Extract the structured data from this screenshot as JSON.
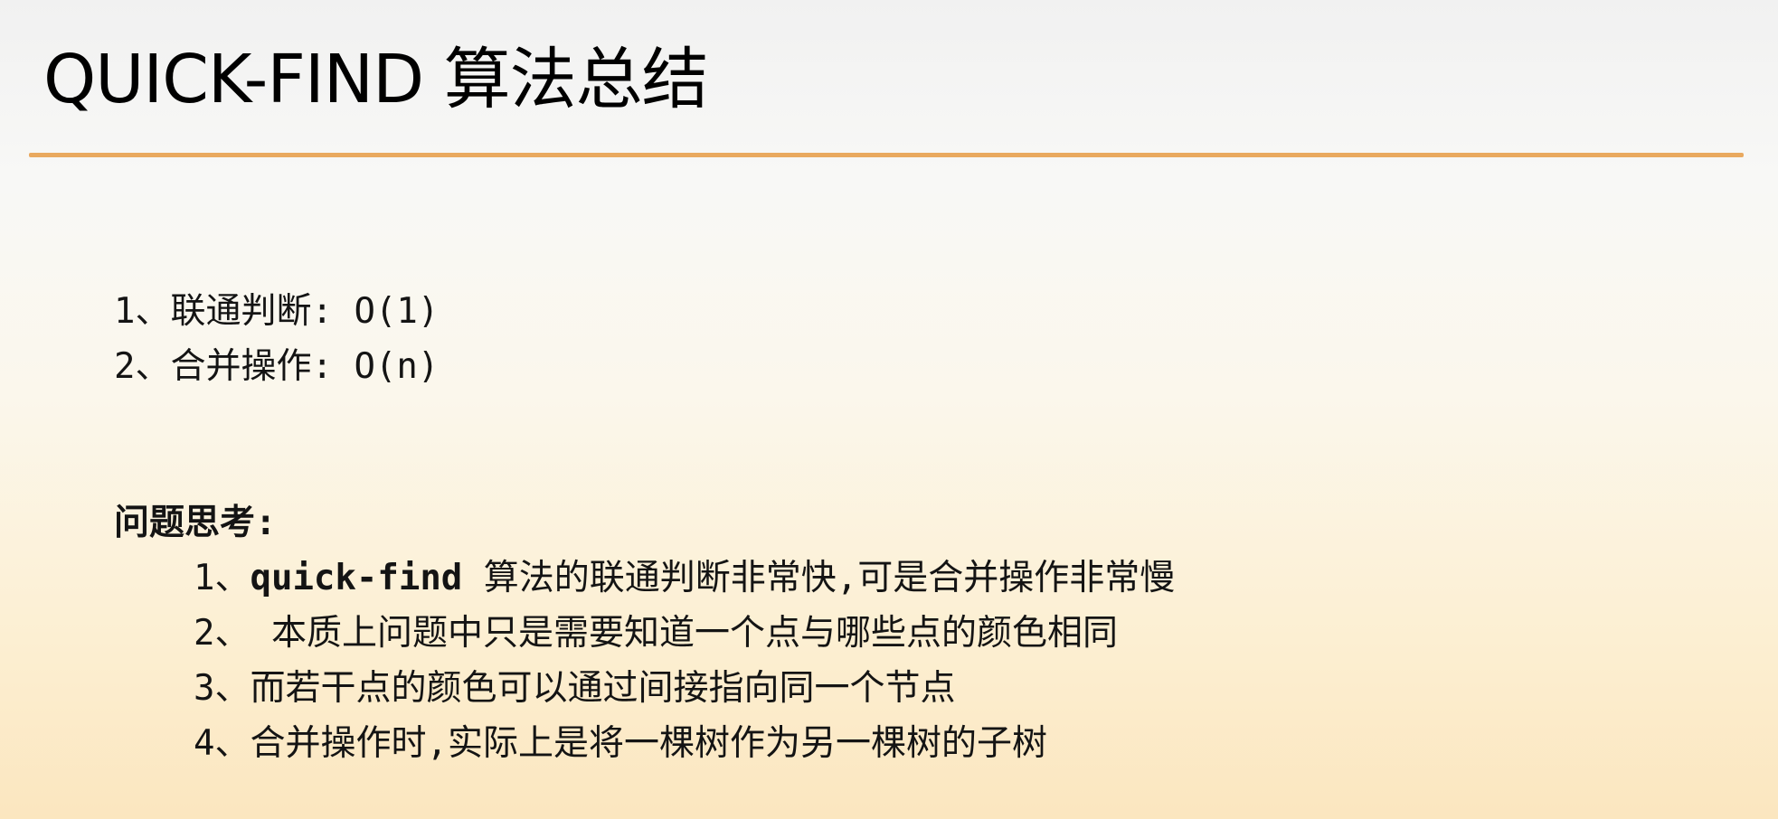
{
  "slide": {
    "title": "QUICK-FIND 算法总结",
    "accent_color": "#e9a95f"
  },
  "complexity": [
    "1、联通判断: O(1)",
    "2、合并操作: O(n)"
  ],
  "thinking": {
    "heading": "问题思考:",
    "items": [
      {
        "prefix": "1、",
        "keyword": "quick-find",
        "text": " 算法的联通判断非常快,可是合并操作非常慢"
      },
      {
        "prefix": "2、",
        "keyword": "",
        "text": " 本质上问题中只是需要知道一个点与哪些点的颜色相同"
      },
      {
        "prefix": "3、",
        "keyword": "",
        "text": "而若干点的颜色可以通过间接指向同一个节点"
      },
      {
        "prefix": "4、",
        "keyword": "",
        "text": "合并操作时,实际上是将一棵树作为另一棵树的子树"
      }
    ]
  }
}
